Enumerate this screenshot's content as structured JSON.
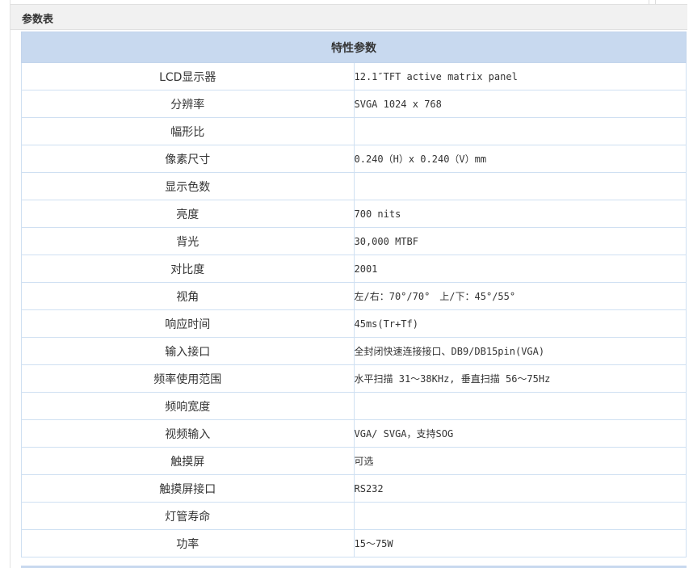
{
  "panel": {
    "title": "参数表"
  },
  "table": {
    "header": "特性参数",
    "rows": [
      {
        "label": "LCD显示器",
        "value": "12.1″TFT active matrix panel"
      },
      {
        "label": "分辨率",
        "value": "SVGA 1024 x 768"
      },
      {
        "label": "幅形比",
        "value": ""
      },
      {
        "label": "像素尺寸",
        "value": "0.240（H）x 0.240（V）mm"
      },
      {
        "label": "显示色数",
        "value": ""
      },
      {
        "label": "亮度",
        "value": "700 nits"
      },
      {
        "label": "背光",
        "value": "30,000 MTBF"
      },
      {
        "label": "对比度",
        "value": "2001"
      },
      {
        "label": "视角",
        "value": "左/右：70°/70°　上/下：45°/55°"
      },
      {
        "label": "响应时间",
        "value": "45ms(Tr+Tf)"
      },
      {
        "label": "输入接口",
        "value": "全封闭快速连接接口、DB9/DB15pin(VGA)"
      },
      {
        "label": "频率使用范围",
        "value": "水平扫描 31～38KHz, 垂直扫描 56～75Hz"
      },
      {
        "label": "频响宽度",
        "value": ""
      },
      {
        "label": "视频输入",
        "value": "VGA/ SVGA，支持SOG"
      },
      {
        "label": "触摸屏",
        "value": "可选"
      },
      {
        "label": "触摸屏接口",
        "value": "RS232"
      },
      {
        "label": "灯管寿命",
        "value": ""
      },
      {
        "label": "功率",
        "value": "15～75W"
      }
    ]
  }
}
